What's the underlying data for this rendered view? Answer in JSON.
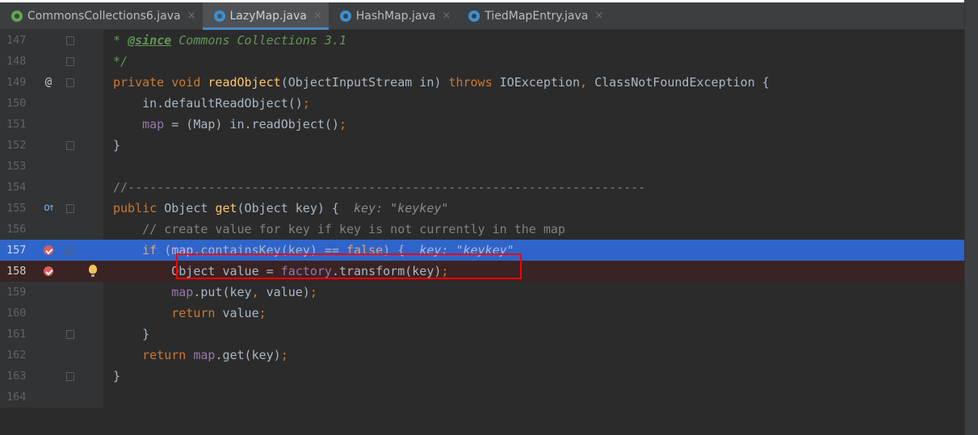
{
  "tabs": [
    {
      "label": "CommonsCollections6.java",
      "icon": "java-file-icon",
      "active": false
    },
    {
      "label": "LazyMap.java",
      "icon": "java-class-icon",
      "active": true
    },
    {
      "label": "HashMap.java",
      "icon": "java-class-icon",
      "active": false
    },
    {
      "label": "TiedMapEntry.java",
      "icon": "java-class-icon",
      "active": false
    }
  ],
  "close_glyph": "×",
  "markers": {
    "override": "@",
    "implements": "o↑"
  },
  "lines": [
    {
      "num": "147",
      "t": [
        [
          "doc",
          "* "
        ],
        [
          "doctag",
          "@since"
        ],
        [
          "doc",
          " Commons Collections 3.1"
        ]
      ]
    },
    {
      "num": "148",
      "t": [
        [
          "doc",
          "*/"
        ]
      ]
    },
    {
      "num": "149",
      "t": [
        [
          "kw",
          "private void "
        ],
        [
          "fn",
          "readObject"
        ],
        [
          "",
          "(ObjectInputStream in) "
        ],
        [
          "kw",
          "throws "
        ],
        [
          "",
          "IOException"
        ],
        [
          "kw",
          ", "
        ],
        [
          "",
          "ClassNotFoundException {"
        ]
      ]
    },
    {
      "num": "150",
      "t": [
        [
          "",
          "    in.defaultReadObject()"
        ],
        [
          "kw",
          ";"
        ]
      ]
    },
    {
      "num": "151",
      "t": [
        [
          "fld",
          "    map"
        ],
        [
          "",
          " = (Map) in.readObject()"
        ],
        [
          "kw",
          ";"
        ]
      ]
    },
    {
      "num": "152",
      "t": [
        [
          "",
          "}"
        ]
      ]
    },
    {
      "num": "153",
      "t": []
    },
    {
      "num": "154",
      "t": [
        [
          "cmt",
          "//-----------------------------------------------------------------------"
        ]
      ]
    },
    {
      "num": "155",
      "t": [
        [
          "kw",
          "public "
        ],
        [
          "",
          "Object "
        ],
        [
          "fn",
          "get"
        ],
        [
          "",
          "(Object key) {  "
        ],
        [
          "hint",
          "key: \"keykey\""
        ]
      ]
    },
    {
      "num": "156",
      "t": [
        [
          "cmt",
          "    // create value for key if key is not currently in the map"
        ]
      ]
    },
    {
      "num": "157",
      "t": [
        [
          "kw",
          "    if "
        ],
        [
          "",
          "("
        ],
        [
          "fld",
          "map"
        ],
        [
          "",
          ".containsKey(key) == "
        ],
        [
          "kw",
          "false"
        ],
        [
          "",
          ") {  "
        ],
        [
          "hint",
          "key: \"keykey\""
        ]
      ]
    },
    {
      "num": "158",
      "t": [
        [
          "",
          "        Object value = "
        ],
        [
          "fld",
          "factory"
        ],
        [
          "",
          ".transform(key)"
        ],
        [
          "kw",
          ";"
        ]
      ]
    },
    {
      "num": "159",
      "t": [
        [
          "fld",
          "        map"
        ],
        [
          "",
          ".put(key"
        ],
        [
          "kw",
          ", "
        ],
        [
          "",
          "value)"
        ],
        [
          "kw",
          ";"
        ]
      ]
    },
    {
      "num": "160",
      "t": [
        [
          "kw",
          "        return "
        ],
        [
          "",
          "value"
        ],
        [
          "kw",
          ";"
        ]
      ]
    },
    {
      "num": "161",
      "t": [
        [
          "",
          "    }"
        ]
      ]
    },
    {
      "num": "162",
      "t": [
        [
          "kw",
          "    return "
        ],
        [
          "fld",
          "map"
        ],
        [
          "",
          ".get(key)"
        ],
        [
          "kw",
          ";"
        ]
      ]
    },
    {
      "num": "163",
      "t": [
        [
          "",
          "}"
        ]
      ]
    },
    {
      "num": "164",
      "t": []
    }
  ]
}
